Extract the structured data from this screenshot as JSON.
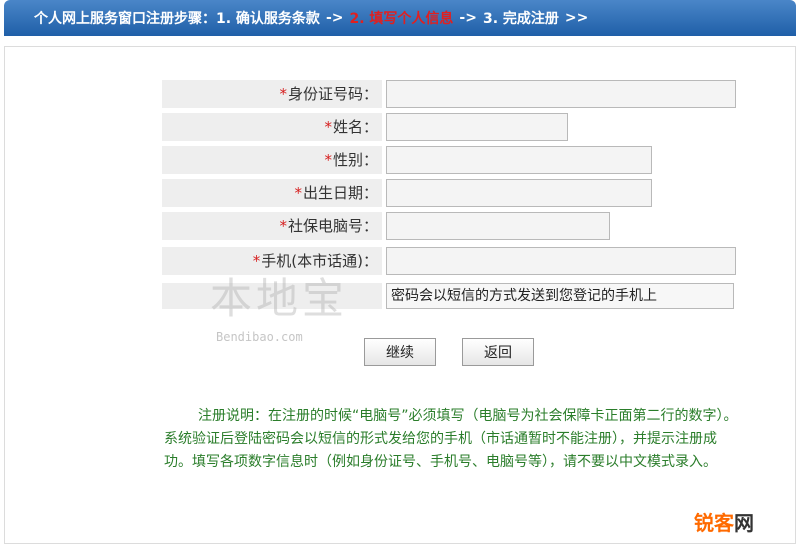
{
  "steps": {
    "prefix": "个人网上服务窗口注册步骤：",
    "step1": "1. 确认服务条款",
    "arrow1": "->",
    "step2": "2. 填写个人信息",
    "arrow2": "->",
    "step3": "3. 完成注册",
    "end": ">>"
  },
  "form": {
    "required_mark": "*",
    "fields": [
      {
        "label": "身份证号码：",
        "value": ""
      },
      {
        "label": "姓名：",
        "value": ""
      },
      {
        "label": "性别：",
        "value": ""
      },
      {
        "label": "出生日期：",
        "value": ""
      },
      {
        "label": "社保电脑号：",
        "value": ""
      },
      {
        "label": "手机(本市话通)：",
        "value": ""
      }
    ],
    "hint": "密码会以短信的方式发送到您登记的手机上"
  },
  "buttons": {
    "continue": "继续",
    "back": "返回"
  },
  "note": "注册说明：在注册的时候“电脑号”必须填写（电脑号为社会保障卡正面第二行的数字）。系统验证后登陆密码会以短信的形式发给您的手机（市话通暂时不能注册），并提示注册成功。填写各项数字信息时（例如身份证号、手机号、电脑号等），请不要以中文模式录入。",
  "watermark": {
    "logo": "本地宝",
    "site": "Bendibao.com"
  },
  "brand": {
    "name_a": "锐客",
    "name_b": "网"
  }
}
